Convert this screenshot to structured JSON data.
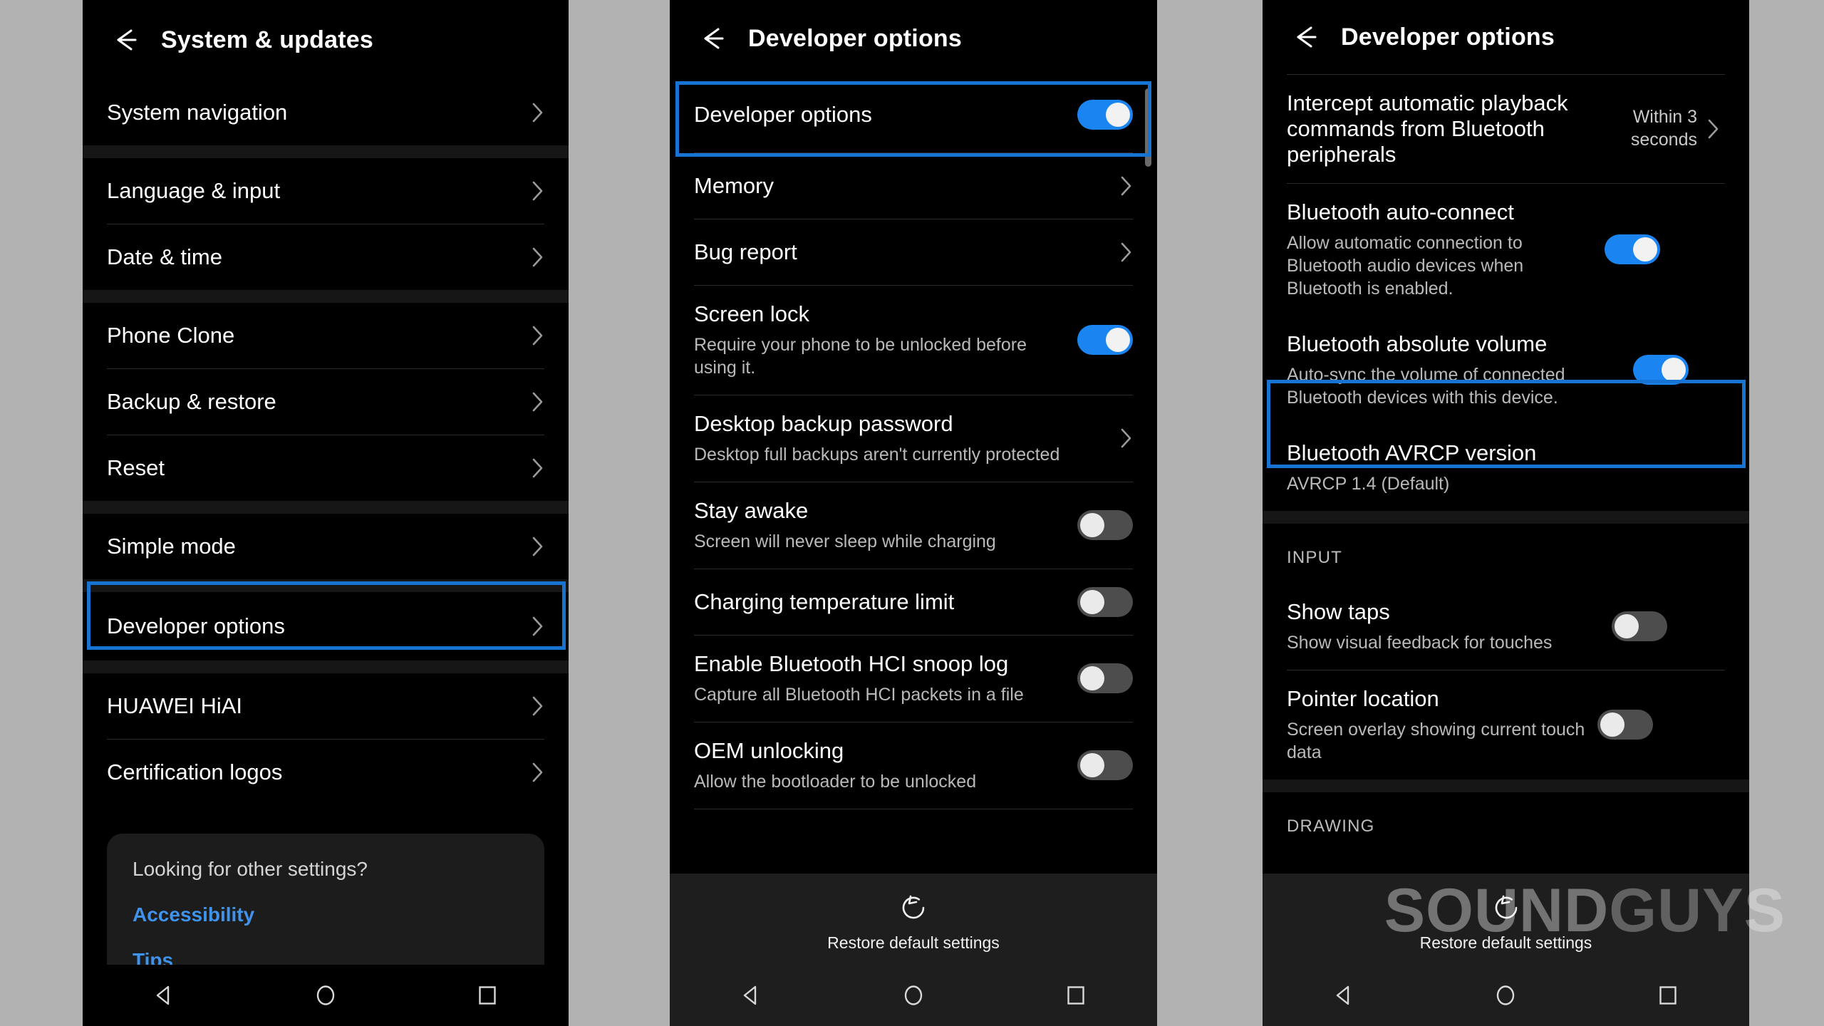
{
  "colors": {
    "highlight": "#1874d2",
    "toggle_on": "#1a84f0",
    "toggle_off": "#4d4d4d",
    "link": "#3f93ec",
    "page_background": "#b2b2b2",
    "screen_background": "#000000"
  },
  "watermark": {
    "bold": "SOUND",
    "light": "GUYS"
  },
  "panel1": {
    "title": "System & updates",
    "back_icon": "back-arrow-icon",
    "groups": [
      {
        "rows": [
          {
            "title": "System navigation",
            "chevron": true
          }
        ]
      },
      {
        "rows": [
          {
            "title": "Language & input",
            "chevron": true
          },
          {
            "title": "Date & time",
            "chevron": true
          }
        ]
      },
      {
        "rows": [
          {
            "title": "Phone Clone",
            "chevron": true
          },
          {
            "title": "Backup & restore",
            "chevron": true
          },
          {
            "title": "Reset",
            "chevron": true
          }
        ]
      },
      {
        "rows": [
          {
            "title": "Simple mode",
            "chevron": true
          }
        ]
      },
      {
        "rows": [
          {
            "title": "Developer options",
            "chevron": true,
            "highlighted": true
          }
        ]
      },
      {
        "rows": [
          {
            "title": "HUAWEI HiAI",
            "chevron": true
          },
          {
            "title": "Certification logos",
            "chevron": true
          }
        ]
      }
    ],
    "card": {
      "question": "Looking for other settings?",
      "links": [
        "Accessibility",
        "Tips"
      ]
    },
    "navbar": [
      "back-triangle-icon",
      "home-circle-icon",
      "recents-square-icon"
    ]
  },
  "panel2": {
    "title": "Developer options",
    "back_icon": "back-arrow-icon",
    "rows": [
      {
        "title": "Developer options",
        "toggle": "on",
        "highlighted": true
      },
      {
        "title": "Memory",
        "chevron": true
      },
      {
        "title": "Bug report",
        "chevron": true
      },
      {
        "title": "Screen lock",
        "sub": "Require your phone to be unlocked before using it.",
        "toggle": "on"
      },
      {
        "title": "Desktop backup password",
        "sub": "Desktop full backups aren't currently protected",
        "chevron": true
      },
      {
        "title": "Stay awake",
        "sub": "Screen will never sleep while charging",
        "toggle": "off"
      },
      {
        "title": "Charging temperature limit",
        "toggle": "off"
      },
      {
        "title": "Enable Bluetooth HCI snoop log",
        "sub": "Capture all Bluetooth HCI packets in a file",
        "toggle": "off"
      },
      {
        "title": "OEM unlocking",
        "sub": "Allow the bootloader to be unlocked",
        "toggle": "off"
      }
    ],
    "restore_label": "Restore default settings",
    "restore_icon": "restore-refresh-icon",
    "navbar": [
      "back-triangle-icon",
      "home-circle-icon",
      "recents-square-icon"
    ]
  },
  "panel3": {
    "title": "Developer options",
    "back_icon": "back-arrow-icon",
    "rows": [
      {
        "title": "Intercept automatic playback commands from Bluetooth peripherals",
        "value": "Within 3 seconds",
        "chevron": true
      },
      {
        "title": "Bluetooth auto-connect",
        "sub": "Allow automatic connection to Bluetooth audio devices when Bluetooth is enabled.",
        "toggle": "on"
      },
      {
        "title": "Bluetooth absolute volume",
        "sub": "Auto-sync the volume of connected Bluetooth devices with this device.",
        "toggle": "on",
        "highlighted": true
      },
      {
        "title": "Bluetooth AVRCP version",
        "sub": "AVRCP 1.4 (Default)"
      }
    ],
    "section_input": "INPUT",
    "input_rows": [
      {
        "title": "Show taps",
        "sub": "Show visual feedback for touches",
        "toggle": "off"
      },
      {
        "title": "Pointer location",
        "sub": "Screen overlay showing current touch data",
        "toggle": "off"
      }
    ],
    "section_drawing": "DRAWING",
    "restore_label": "Restore default settings",
    "restore_icon": "restore-refresh-icon",
    "navbar": [
      "back-triangle-icon",
      "home-circle-icon",
      "recents-square-icon"
    ]
  }
}
